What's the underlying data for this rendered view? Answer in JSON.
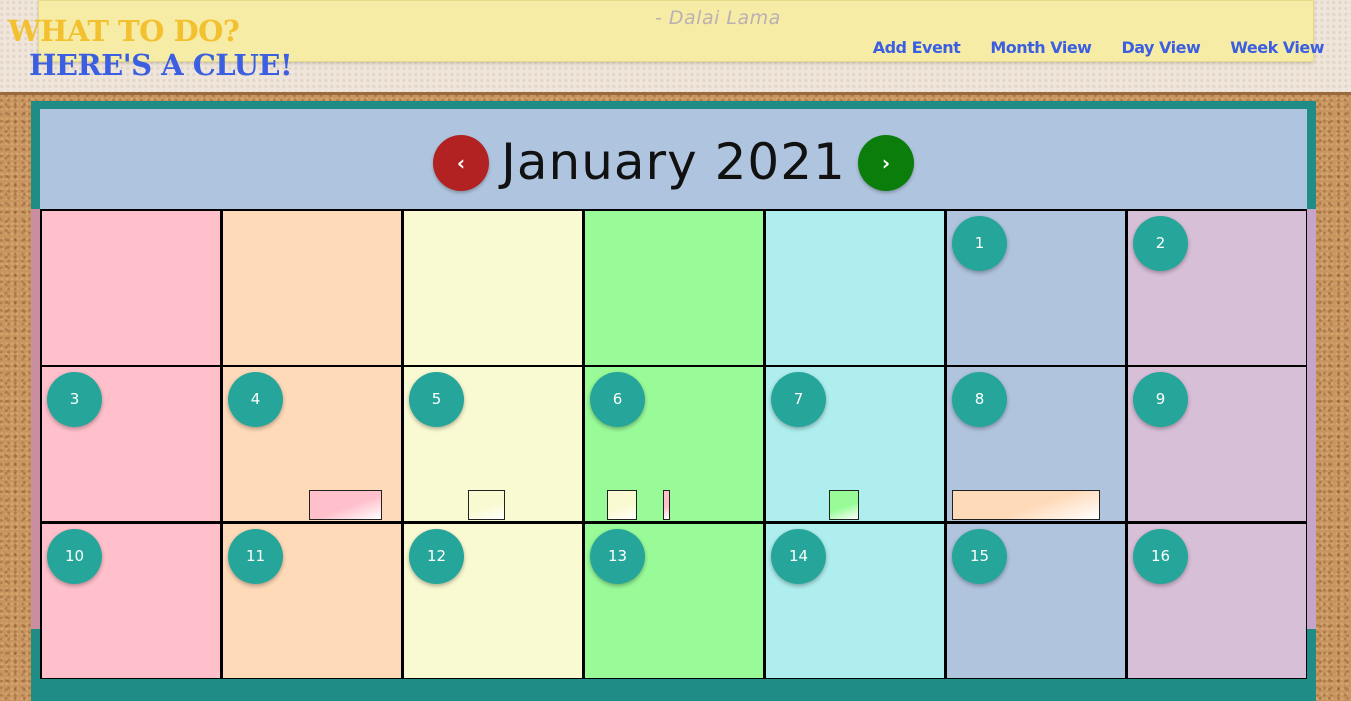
{
  "header": {
    "logo_line1": "WHAT TO DO?",
    "logo_line2": "HERE'S A CLUE!",
    "quote_author": "- Dalai Lama",
    "nav": [
      {
        "label": "Add Event"
      },
      {
        "label": "Month View"
      },
      {
        "label": "Day View"
      },
      {
        "label": "Week View"
      }
    ]
  },
  "calendar": {
    "month_title": "January 2021",
    "prev_label": "‹",
    "next_label": "›",
    "column_colors": [
      "#ffc0cb",
      "#ffdab9",
      "#fafad2",
      "#98fb98",
      "#afeeee",
      "#b0c4de",
      "#d8bfd8"
    ],
    "weeks": [
      [
        "",
        "",
        "",
        "",
        "",
        "1",
        "2"
      ],
      [
        "3",
        "4",
        "5",
        "6",
        "7",
        "8",
        "9"
      ],
      [
        "10",
        "11",
        "12",
        "13",
        "14",
        "15",
        "16"
      ]
    ],
    "events": [
      {
        "day": "4",
        "color": "#ffc0cb"
      },
      {
        "day": "5",
        "color": "#fafad2"
      },
      {
        "day": "6",
        "color": "#fafad2"
      },
      {
        "day": "6",
        "color": "#ffc0cb"
      },
      {
        "day": "7",
        "color": "#98fb98"
      },
      {
        "day": "8",
        "color": "#ffdab9"
      }
    ]
  }
}
